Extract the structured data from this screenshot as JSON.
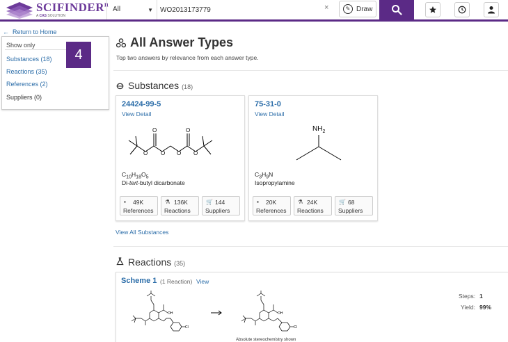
{
  "header": {
    "logo_text": "SCIFINDER",
    "logo_sup": "n",
    "logo_sub_prefix": "A ",
    "logo_sub_brand": "CAS",
    "logo_sub_suffix": " SOLUTION",
    "scope_value": "All",
    "search_value": "WO2013173779",
    "draw_label": "Draw"
  },
  "sidebar": {
    "return_label": "Return to Home",
    "show_only_label": "Show only",
    "filters": [
      {
        "label": "Substances (18)",
        "color": "#2a6ca8"
      },
      {
        "label": "Reactions (35)",
        "color": "#2a6ca8"
      },
      {
        "label": "References (2)",
        "color": "#2a6ca8"
      },
      {
        "label": "Suppliers (0)",
        "color": "#333333"
      }
    ],
    "badge": "4"
  },
  "main": {
    "title": "All Answer Types",
    "subtitle": "Top two answers by relevance from each answer type."
  },
  "substances": {
    "title": "Substances",
    "count": "(18)",
    "view_all": "View All Substances",
    "cards": [
      {
        "cas": "24424-99-5",
        "view_detail": "View Detail",
        "formula_html": "C<sub>10</sub>H<sub>18</sub>O<sub>5</sub>",
        "name_html": "Di-<i>tert</i>-butyl dicarbonate",
        "references_count": "49K",
        "references_label": "References",
        "reactions_count": "136K",
        "reactions_label": "Reactions",
        "suppliers_count": "144",
        "suppliers_label": "Suppliers"
      },
      {
        "cas": "75-31-0",
        "view_detail": "View Detail",
        "formula_html": "C<sub>3</sub>H<sub>9</sub>N",
        "name_html": "Isopropylamine",
        "nh2_label": "NH",
        "nh2_sub": "2",
        "references_count": "20K",
        "references_label": "References",
        "reactions_count": "24K",
        "reactions_label": "Reactions",
        "suppliers_count": "68",
        "suppliers_label": "Suppliers"
      }
    ]
  },
  "reactions": {
    "title": "Reactions",
    "count": "(35)",
    "scheme_title": "Scheme 1",
    "scheme_count": "(1 Reaction)",
    "scheme_view": "View",
    "abs_note": "Absolute stereochemistry shown",
    "steps_label": "Steps:",
    "steps_value": "1",
    "yield_label": "Yield:",
    "yield_value": "99%"
  },
  "colors": {
    "brand": "#5b2a86",
    "link": "#2a6ca8"
  }
}
